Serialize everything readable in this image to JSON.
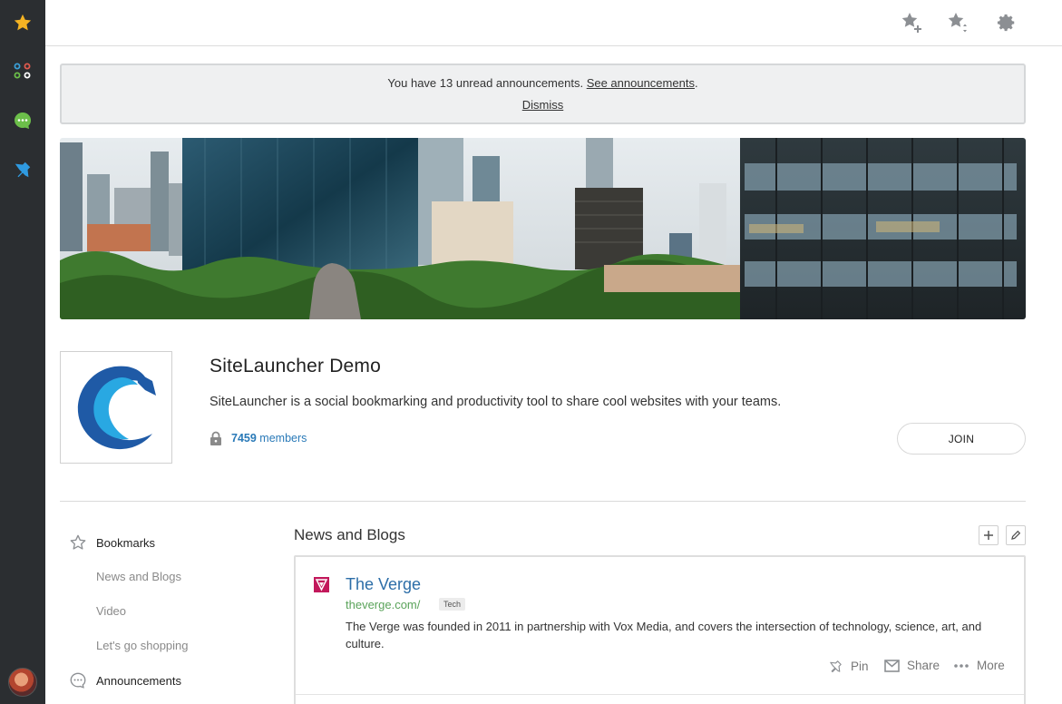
{
  "colors": {
    "rail_bg": "#2b2e31",
    "link_blue": "#2a7ab8",
    "url_green": "#5aa35a",
    "star_gold": "#f4b323"
  },
  "rail": {
    "items": [
      {
        "icon": "star-icon"
      },
      {
        "icon": "apps-dots-icon"
      },
      {
        "icon": "chat-bubble-icon"
      },
      {
        "icon": "pin-icon"
      }
    ],
    "avatar": "user-avatar"
  },
  "topbar": {
    "icons": [
      "star-add-icon",
      "star-sort-icon",
      "gear-icon"
    ]
  },
  "announcement": {
    "text_prefix": "You have 13 unread announcements.",
    "link": "See announcements",
    "suffix": ".",
    "dismiss": "Dismiss"
  },
  "group": {
    "title": "SiteLauncher Demo",
    "description": "SiteLauncher is a social bookmarking and productivity tool to share cool websites with your teams.",
    "member_count": "7459",
    "members_label": "members",
    "join_label": "JOIN"
  },
  "nav": {
    "bookmarks": "Bookmarks",
    "sub_items": [
      "News and Blogs",
      "Video",
      "Let's go shopping"
    ],
    "announcements": "Announcements"
  },
  "section": {
    "title": "News and Blogs"
  },
  "card": {
    "title": "The Verge",
    "url": "theverge.com/",
    "tag": "Tech",
    "description": "The Verge was founded in 2011 in partnership with Vox Media, and covers the intersection of technology, science, art, and culture.",
    "actions": {
      "pin": "Pin",
      "share": "Share",
      "more": "More"
    }
  }
}
